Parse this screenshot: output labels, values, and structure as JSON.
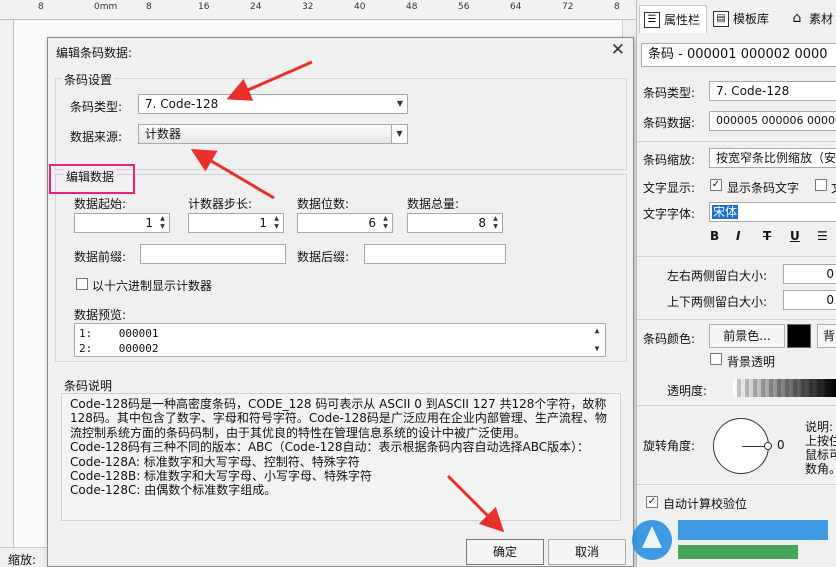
{
  "ruler": {
    "marks": [
      "8",
      "0mm",
      "8",
      "16",
      "24",
      "32",
      "40",
      "48",
      "56",
      "64",
      "72",
      "8"
    ]
  },
  "status": {
    "zoom_label": "缩放:"
  },
  "dialog": {
    "title": "编辑条码数据:",
    "group1_title": "条码设置",
    "type_label": "条码类型:",
    "type_value": "7. Code-128",
    "source_label": "数据来源:",
    "source_value": "计数器",
    "group2_title": "编辑数据",
    "start_label": "数据起始:",
    "start_value": "1",
    "step_label": "计数器步长:",
    "step_value": "1",
    "digits_label": "数据位数:",
    "digits_value": "6",
    "total_label": "数据总量:",
    "total_value": "8",
    "prefix_label": "数据前缀:",
    "suffix_label": "数据后缀:",
    "hex_label": "以十六进制显示计数器",
    "hex_checked": false,
    "preview_label": "数据预览:",
    "preview_rows": [
      "1:    000001",
      "2:    000002"
    ],
    "desc_title": "条码说明",
    "desc_lines": [
      "Code-128码是一种高密度条码，CODE_128 码可表示从 ASCII 0 到ASCII 127 共128个字符，故称128码。其中包含了数字、字母和符号字符。Code-128码是广泛应用在企业内部管理、生产流程、物流控制系统方面的条码码制，由于其优良的特性在管理信息系统的设计中被广泛使用。",
      "",
      "Code-128码有三种不同的版本：ABC（Code-128自动：表示根据条码内容自动选择ABC版本）：",
      "Code-128A: 标准数字和大写字母、控制符、特殊字符",
      "Code-128B: 标准数字和大写字母、小写字母、特殊字符",
      "Code-128C: 由偶数个标准数字组成。"
    ],
    "ok_label": "确定",
    "cancel_label": "取消"
  },
  "panel": {
    "tab_props": "属性栏",
    "tab_templates": "模板库",
    "tab_assets": "素材",
    "header_value": "条码 - 000001 000002 0000",
    "type_label": "条码类型:",
    "type_value": "7. Code-128",
    "data_label": "条码数据:",
    "data_value": "000005 000006 000007",
    "scale_label": "条码缩放:",
    "scale_value": "按宽窄条比例缩放（安全",
    "textshow_label": "文字显示:",
    "textshow_option": "显示条码文字",
    "textshow_option2": "文",
    "font_label": "文字字体:",
    "font_value": "宋体",
    "fmt_bold": "B",
    "fmt_italic": "I",
    "fmt_strike": "T",
    "fmt_underline": "U",
    "lr_margin_label": "左右两侧留白大小:",
    "lr_margin_value": "0",
    "tb_margin_label": "上下两侧留白大小:",
    "tb_margin_value": "0",
    "color_label": "条码颜色:",
    "fg_button": "前景色...",
    "bg_button": "背",
    "bg_transparent": "背景透明",
    "opacity_label": "透明度:",
    "rotation_label": "旋转角度:",
    "rotation_value": "0",
    "note_lines": [
      "说明:",
      "上按住",
      "鼠标可",
      "数角。"
    ],
    "auto_check_label": "自动计算校验位",
    "swatch_color": "#000000"
  },
  "annotations": {
    "arrow_color": "#e8312a",
    "highlight_color": "#e6237e"
  }
}
